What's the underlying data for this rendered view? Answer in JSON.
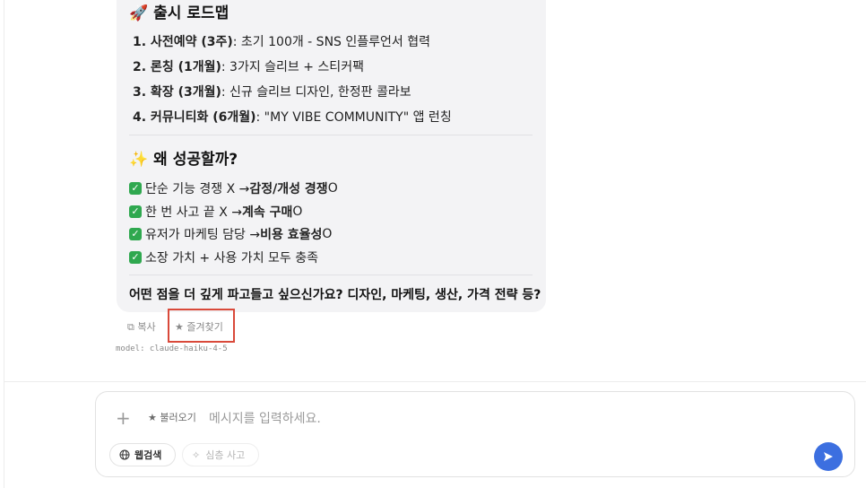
{
  "message": {
    "roadmap": {
      "emoji": "🚀",
      "title": "출시 로드맵",
      "items": [
        {
          "label": "1. 사전예약 (3주)",
          "text": ": 초기 100개 - SNS 인플루언서 협력"
        },
        {
          "label": "2. 론칭 (1개월)",
          "text": ": 3가지 슬리브 + 스티커팩"
        },
        {
          "label": "3. 확장 (3개월)",
          "text": ": 신규 슬리브 디자인, 한정판 콜라보"
        },
        {
          "label": "4. 커뮤니티화 (6개월)",
          "text": ": \"MY VIBE COMMUNITY\" 앱 런칭"
        }
      ]
    },
    "why": {
      "emoji": "✨",
      "title": "왜 성공할까?",
      "checks": [
        {
          "pre": "단순 기능 경쟁 X → ",
          "bold": "감정/개성 경쟁",
          "post": " O"
        },
        {
          "pre": "한 번 사고 끝 X → ",
          "bold": "계속 구매",
          "post": " O"
        },
        {
          "pre": "유저가 마케팅 담당 → ",
          "bold": "비용 효율성",
          "post": " O"
        },
        {
          "pre": "소장 가치 + 사용 가치 모두 충족",
          "bold": "",
          "post": ""
        }
      ]
    },
    "question": "어떤 점을 더 깊게 파고들고 싶으신가요? 디자인, 마케팅, 생산, 가격 전략 등?"
  },
  "actions": {
    "copy_label": "복사",
    "favorite_label": "즐겨찾기"
  },
  "model_line": "model: claude-haiku-4-5",
  "composer": {
    "load_label": "불러오기",
    "placeholder": "메시지를 입력하세요.",
    "web_search_label": "웹검색",
    "deep_think_label": "심층 사고"
  },
  "colors": {
    "highlight_box": "#d9493a",
    "send_button": "#3c6fe0",
    "check_green": "#2fa84f",
    "bubble_bg": "#f3f3f5"
  }
}
